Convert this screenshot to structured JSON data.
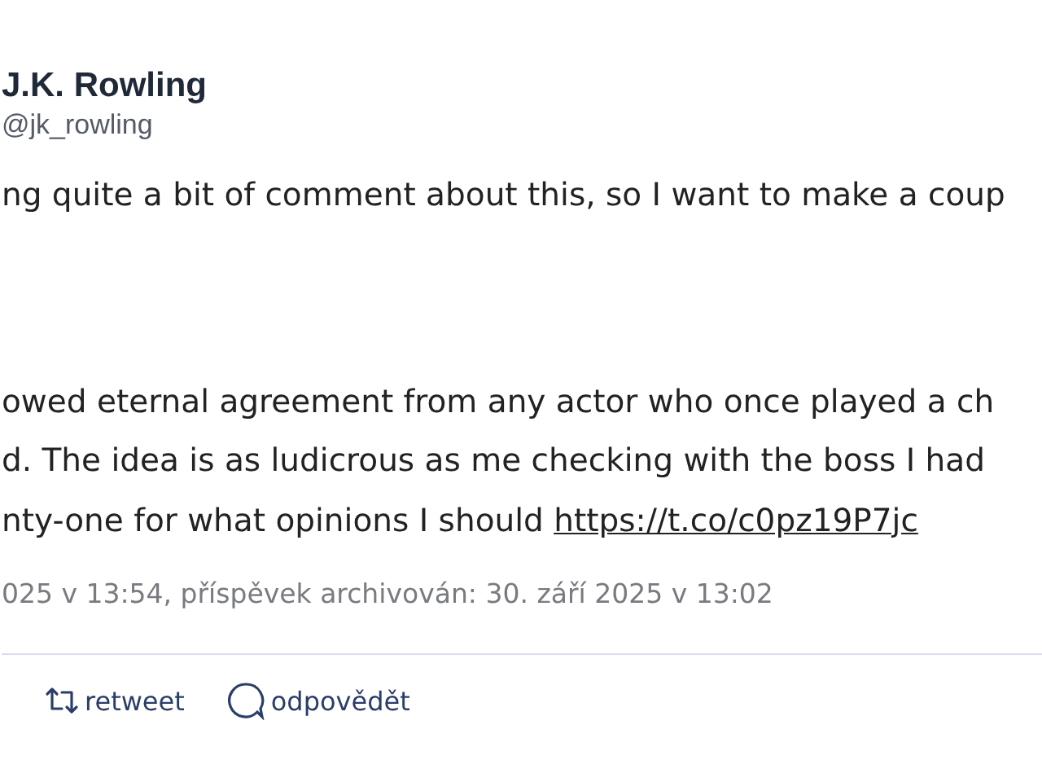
{
  "author": {
    "name": "J.K. Rowling",
    "handle": "@jk_rowling"
  },
  "body": {
    "paragraphs": [
      [
        "ng quite a bit of comment about this, so I want to make a coup"
      ],
      [
        "owed eternal agreement from any actor who once played a ch",
        "d. The idea is as ludicrous as me checking with the boss I had"
      ]
    ],
    "last_line": "nty-one for what opinions I should ",
    "link": "https://t.co/c0pz19P7jc"
  },
  "meta": "025 v 13:54, příspěvek archivován: 30. září 2025 v 13:02",
  "actions": [
    {
      "kind": "retweet",
      "label": "retweet"
    },
    {
      "kind": "reply",
      "label": "odpovědět"
    }
  ]
}
